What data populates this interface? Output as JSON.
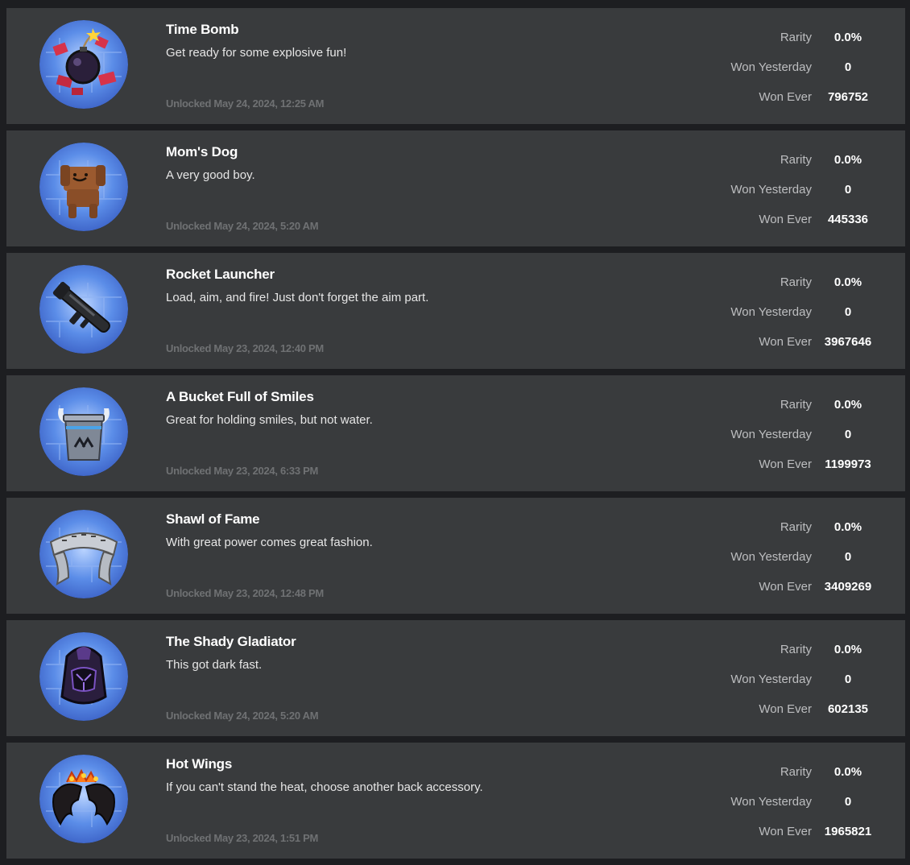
{
  "labels": {
    "rarity": "Rarity",
    "won_yesterday": "Won Yesterday",
    "won_ever": "Won Ever"
  },
  "badges": [
    {
      "name": "Time Bomb",
      "description": "Get ready for some explosive fun!",
      "unlocked": "Unlocked May 24, 2024, 12:25 AM",
      "rarity": "0.0%",
      "won_yesterday": "0",
      "won_ever": "796752",
      "icon": "time-bomb-icon"
    },
    {
      "name": "Mom's Dog",
      "description": "A very good boy.",
      "unlocked": "Unlocked May 24, 2024, 5:20 AM",
      "rarity": "0.0%",
      "won_yesterday": "0",
      "won_ever": "445336",
      "icon": "dog-icon"
    },
    {
      "name": "Rocket Launcher",
      "description": "Load, aim, and fire! Just don't forget the aim part.",
      "unlocked": "Unlocked May 23, 2024, 12:40 PM",
      "rarity": "0.0%",
      "won_yesterday": "0",
      "won_ever": "3967646",
      "icon": "rocket-launcher-icon"
    },
    {
      "name": "A Bucket Full of Smiles",
      "description": "Great for holding smiles, but not water.",
      "unlocked": "Unlocked May 23, 2024, 6:33 PM",
      "rarity": "0.0%",
      "won_yesterday": "0",
      "won_ever": "1199973",
      "icon": "bucket-helmet-icon"
    },
    {
      "name": "Shawl of Fame",
      "description": "With great power comes great fashion.",
      "unlocked": "Unlocked May 23, 2024, 12:48 PM",
      "rarity": "0.0%",
      "won_yesterday": "0",
      "won_ever": "3409269",
      "icon": "shawl-icon"
    },
    {
      "name": "The Shady Gladiator",
      "description": "This got dark fast.",
      "unlocked": "Unlocked May 24, 2024, 5:20 AM",
      "rarity": "0.0%",
      "won_yesterday": "0",
      "won_ever": "602135",
      "icon": "gladiator-helmet-icon"
    },
    {
      "name": "Hot Wings",
      "description": "If you can't stand the heat, choose another back accessory.",
      "unlocked": "Unlocked May 23, 2024, 1:51 PM",
      "rarity": "0.0%",
      "won_yesterday": "0",
      "won_ever": "1965821",
      "icon": "hot-wings-icon"
    }
  ],
  "colors": {
    "page_background": "#1d1e21",
    "card_background": "#393b3d",
    "unlocked_text": "#6f7173",
    "label_text": "#bdbec0",
    "icon_background": "#5b8de8"
  }
}
